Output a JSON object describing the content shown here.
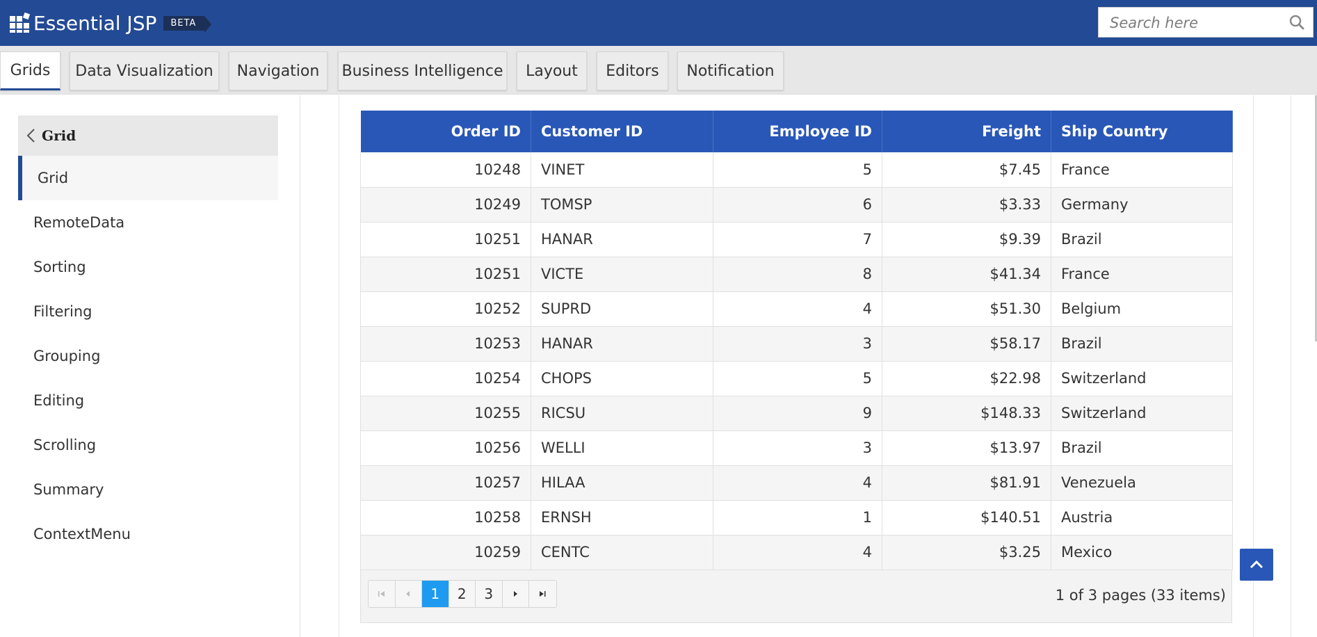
{
  "header": {
    "brand": "Essential JSP",
    "badge": "BETA",
    "search_placeholder": "Search here"
  },
  "tabs": [
    {
      "label": "Grids",
      "active": true
    },
    {
      "label": "Data Visualization"
    },
    {
      "label": "Navigation"
    },
    {
      "label": "Business Intelligence"
    },
    {
      "label": "Layout"
    },
    {
      "label": "Editors"
    },
    {
      "label": "Notification"
    }
  ],
  "sidebar": {
    "section": "Grid",
    "active_item": "Grid",
    "items": [
      "RemoteData",
      "Sorting",
      "Filtering",
      "Grouping",
      "Editing",
      "Scrolling",
      "Summary",
      "ContextMenu"
    ]
  },
  "grid": {
    "columns": [
      "Order ID",
      "Customer ID",
      "Employee ID",
      "Freight",
      "Ship Country"
    ],
    "rows": [
      [
        "10248",
        "VINET",
        "5",
        "$7.45",
        "France"
      ],
      [
        "10249",
        "TOMSP",
        "6",
        "$3.33",
        "Germany"
      ],
      [
        "10251",
        "HANAR",
        "7",
        "$9.39",
        "Brazil"
      ],
      [
        "10251",
        "VICTE",
        "8",
        "$41.34",
        "France"
      ],
      [
        "10252",
        "SUPRD",
        "4",
        "$51.30",
        "Belgium"
      ],
      [
        "10253",
        "HANAR",
        "3",
        "$58.17",
        "Brazil"
      ],
      [
        "10254",
        "CHOPS",
        "5",
        "$22.98",
        "Switzerland"
      ],
      [
        "10255",
        "RICSU",
        "9",
        "$148.33",
        "Switzerland"
      ],
      [
        "10256",
        "WELLI",
        "3",
        "$13.97",
        "Brazil"
      ],
      [
        "10257",
        "HILAA",
        "4",
        "$81.91",
        "Venezuela"
      ],
      [
        "10258",
        "ERNSH",
        "1",
        "$140.51",
        "Austria"
      ],
      [
        "10259",
        "CENTC",
        "4",
        "$3.25",
        "Mexico"
      ]
    ]
  },
  "pager": {
    "pages": [
      "1",
      "2",
      "3"
    ],
    "current": "1",
    "info": "1 of 3 pages (33 items)"
  },
  "colors": {
    "header_bg": "#234a94",
    "grid_header_bg": "#2957b7",
    "active_page": "#1e9bf0"
  }
}
